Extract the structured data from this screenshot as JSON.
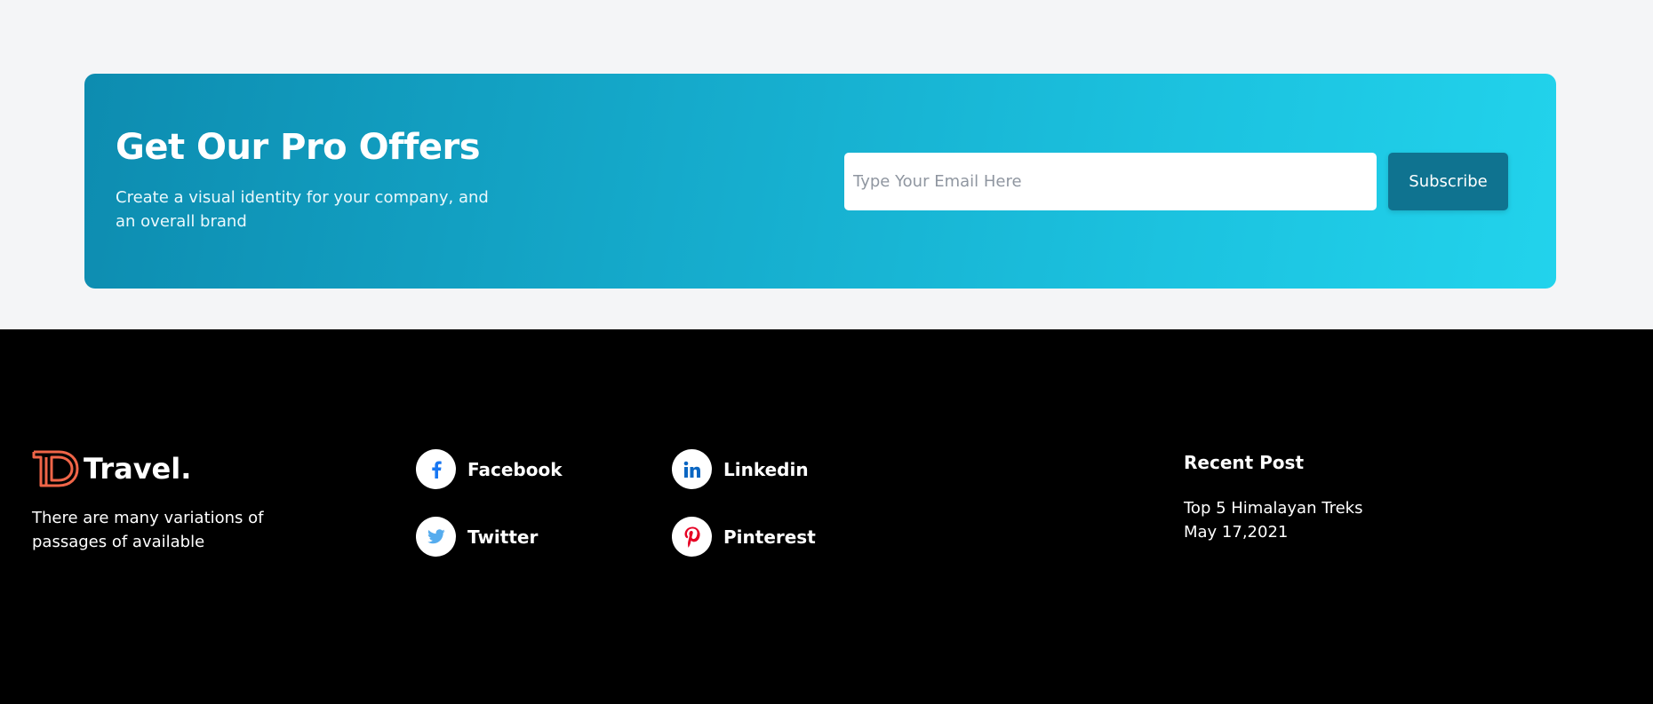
{
  "offer": {
    "title": "Get Our Pro Offers",
    "subtitle": "Create a visual identity for your company, and an overall brand",
    "email_placeholder": "Type Your Email Here",
    "subscribe_label": "Subscribe"
  },
  "footer": {
    "brand_name": "Travel.",
    "brand_description": "There are many variations of passages of available",
    "social": {
      "facebook": "Facebook",
      "twitter": "Twitter",
      "linkedin": "Linkedin",
      "pinterest": "Pinterest"
    },
    "recent_post": {
      "heading": "Recent Post",
      "title": "Top 5 Himalayan Treks",
      "date": "May 17,2021"
    }
  },
  "colors": {
    "accent_logo": "#f06548",
    "banner_start": "#0d8cb0",
    "banner_end": "#22d3ec",
    "button": "#0f7390",
    "facebook": "#1877f2",
    "twitter": "#55acee",
    "linkedin": "#0a66c2",
    "pinterest": "#e60023"
  },
  "icons": [
    "brand-logo-icon",
    "facebook-icon",
    "twitter-icon",
    "linkedin-icon",
    "pinterest-icon"
  ]
}
